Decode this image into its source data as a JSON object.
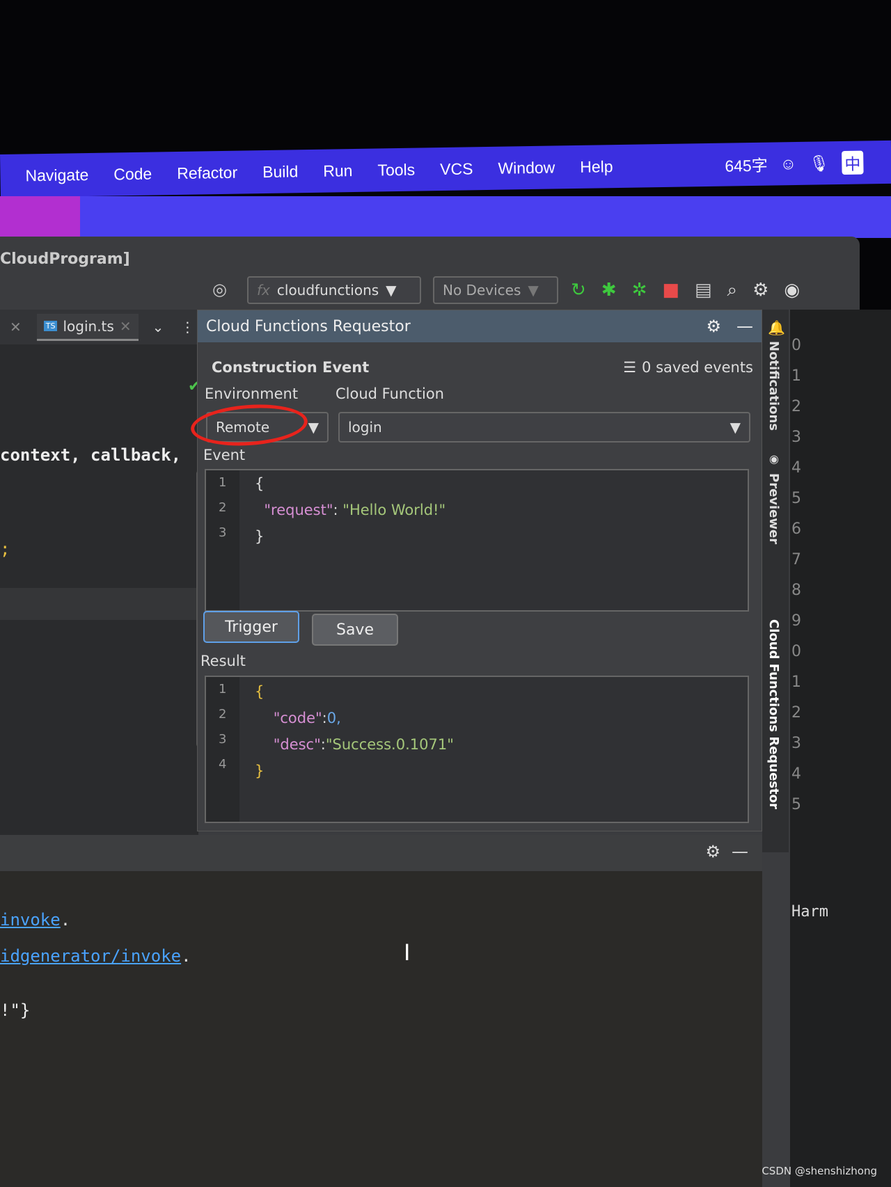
{
  "menubar": {
    "items": [
      "Navigate",
      "Code",
      "Refactor",
      "Build",
      "Run",
      "Tools",
      "VCS",
      "Window",
      "Help"
    ],
    "word_count": "645字",
    "ime": "中"
  },
  "window": {
    "title": "CloudProgram]"
  },
  "toolbar": {
    "config": "cloudfunctions",
    "devices": "No Devices"
  },
  "editor": {
    "tab": "login.ts",
    "tab_badge": "TS",
    "code_line": "context, callback,",
    "semicolon": ";"
  },
  "panel": {
    "title": "Cloud Functions Requestor",
    "section": "Construction Event",
    "saved": "0 saved events",
    "env_label": "Environment",
    "env_value": "Remote",
    "fn_label": "Cloud Function",
    "fn_value": "login",
    "event_label": "Event",
    "event_lines": [
      {
        "n": "1",
        "t": "{"
      },
      {
        "n": "2",
        "k": "\"request\"",
        "s": "\"Hello World!\""
      },
      {
        "n": "3",
        "t": "}"
      }
    ],
    "trigger": "Trigger",
    "save": "Save",
    "result_label": "Result",
    "result_lines": [
      {
        "n": "1",
        "t": "{"
      },
      {
        "n": "2",
        "k": "\"code\"",
        "v": "0,"
      },
      {
        "n": "3",
        "k": "\"desc\"",
        "s": "\"Success.0.1071\""
      },
      {
        "n": "4",
        "t": "}"
      }
    ]
  },
  "side": {
    "notifications": "Notifications",
    "previewer": "Previewer",
    "requestor": "Cloud Functions Requestor"
  },
  "far": {
    "lines": [
      "0",
      "1",
      "2",
      "3",
      "4",
      "5",
      "6",
      "7",
      "8",
      "9",
      "0",
      "1",
      "2",
      "3",
      "4",
      "5"
    ],
    "word": "Harm"
  },
  "bottom": {
    "line1": "invoke",
    "line2": "idgenerator/invoke",
    "line3": "!\"}",
    "dot": "."
  },
  "watermark": "CSDN @shenshizhong",
  "colors": {
    "menubar": "#3b2fe0",
    "panel_header": "#4c5c6c",
    "annotation": "#e8231c"
  }
}
